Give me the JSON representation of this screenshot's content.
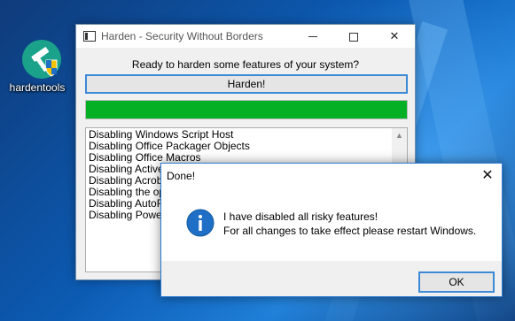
{
  "desktop": {
    "icon_label": "hardentools",
    "icon_name": "hammer-shield-icon"
  },
  "main_window": {
    "title": "Harden - Security Without Borders",
    "prompt": "Ready to harden some features of your system?",
    "harden_button": "Harden!",
    "progress_fraction": 1.0,
    "progress_color": "#06b025",
    "log_lines": [
      "Disabling Windows Script Host",
      "Disabling Office Packager Objects",
      "Disabling Office Macros",
      "Disabling ActiveX",
      "Disabling Acrobat",
      "Disabling the oper",
      "Disabling AutoRun",
      "Disabling Powersh"
    ]
  },
  "dialog": {
    "title": "Done!",
    "message_line1": "I have disabled all risky features!",
    "message_line2": "For all changes to take effect please restart Windows.",
    "ok_button": "OK",
    "icon_name": "info-icon",
    "accent_color": "#1f6fc6"
  }
}
